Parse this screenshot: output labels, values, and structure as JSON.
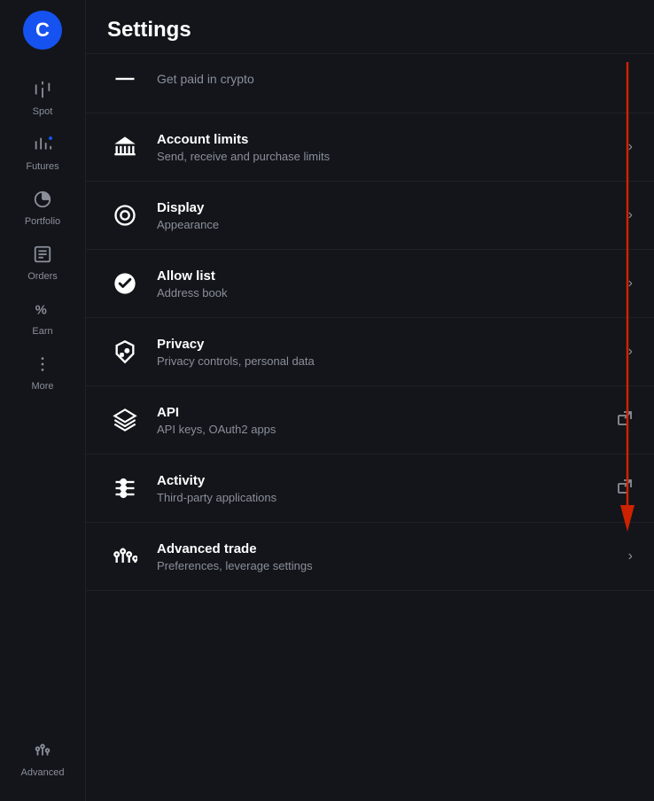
{
  "app": {
    "logo": "C",
    "title": "Settings"
  },
  "sidebar": {
    "items": [
      {
        "id": "spot",
        "label": "Spot",
        "icon": "spot",
        "hasDot": false
      },
      {
        "id": "futures",
        "label": "Futures",
        "icon": "futures",
        "hasDot": true
      },
      {
        "id": "portfolio",
        "label": "Portfolio",
        "icon": "portfolio",
        "hasDot": false
      },
      {
        "id": "orders",
        "label": "Orders",
        "icon": "orders",
        "hasDot": false
      },
      {
        "id": "earn",
        "label": "Earn",
        "icon": "earn",
        "hasDot": false
      },
      {
        "id": "more",
        "label": "More",
        "icon": "more",
        "hasDot": false
      }
    ],
    "bottom": [
      {
        "id": "advanced",
        "label": "Advanced",
        "icon": "advanced"
      }
    ]
  },
  "settings": {
    "partial_item": {
      "text": "Get paid in crypto"
    },
    "items": [
      {
        "id": "account-limits",
        "name": "Account limits",
        "desc": "Send, receive and purchase limits",
        "chevron": "›",
        "external": false
      },
      {
        "id": "display",
        "name": "Display",
        "desc": "Appearance",
        "chevron": "›",
        "external": false
      },
      {
        "id": "allow-list",
        "name": "Allow list",
        "desc": "Address book",
        "chevron": "›",
        "external": false
      },
      {
        "id": "privacy",
        "name": "Privacy",
        "desc": "Privacy controls, personal data",
        "chevron": "›",
        "external": false
      },
      {
        "id": "api",
        "name": "API",
        "desc": "API keys, OAuth2 apps",
        "chevron": "⧉",
        "external": true
      },
      {
        "id": "activity",
        "name": "Activity",
        "desc": "Third-party applications",
        "chevron": "⧉",
        "external": true
      },
      {
        "id": "advanced-trade",
        "name": "Advanced trade",
        "desc": "Preferences, leverage settings",
        "chevron": "›",
        "external": false
      }
    ]
  }
}
